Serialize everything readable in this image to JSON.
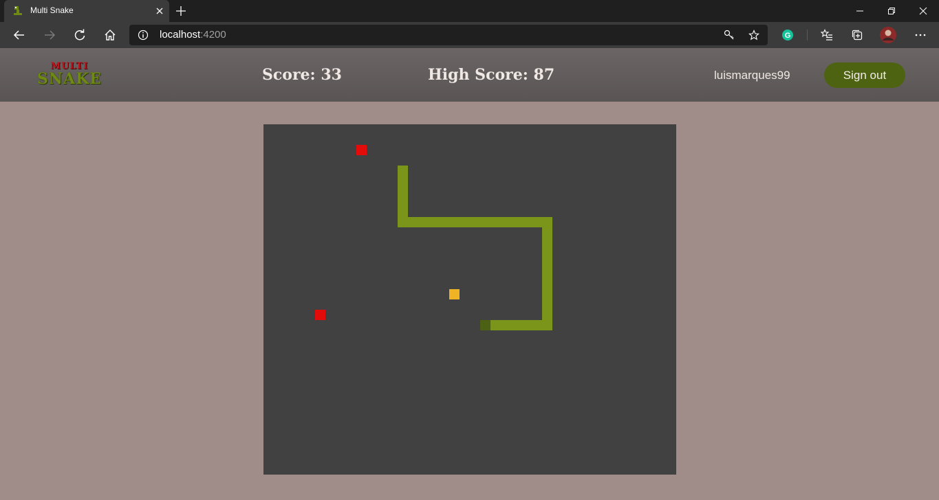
{
  "browser": {
    "tab_title": "Multi Snake",
    "url_host": "localhost",
    "url_port": ":4200",
    "icons": {
      "back": "arrow-left-icon",
      "forward": "arrow-right-icon",
      "refresh": "refresh-icon",
      "home": "home-icon",
      "info": "info-icon",
      "key": "key-icon",
      "favorite": "star-icon",
      "grammarly": "grammarly-icon",
      "favorites_bar": "favorites-icon",
      "collections": "collections-icon",
      "profile": "profile-avatar",
      "more": "more-icon"
    }
  },
  "header": {
    "logo_top": "MULTI",
    "logo_bottom": "SNAKE",
    "score_text": "Score: 33",
    "high_score_text": "High Score: 87",
    "username": "luismarques99",
    "signout_label": "Sign out"
  },
  "game": {
    "grid_columns": 40,
    "grid_rows": 34,
    "colors": {
      "board": "#414141",
      "snake_body": "#7a951a",
      "snake_tail": "#4d6114",
      "food": "#e40b0b",
      "bonus": "#f0b323"
    },
    "snake": [
      [
        13,
        4
      ],
      [
        13,
        5
      ],
      [
        13,
        6
      ],
      [
        13,
        7
      ],
      [
        13,
        8
      ],
      [
        13,
        9
      ],
      [
        14,
        9
      ],
      [
        15,
        9
      ],
      [
        16,
        9
      ],
      [
        17,
        9
      ],
      [
        18,
        9
      ],
      [
        19,
        9
      ],
      [
        20,
        9
      ],
      [
        21,
        9
      ],
      [
        22,
        9
      ],
      [
        23,
        9
      ],
      [
        24,
        9
      ],
      [
        25,
        9
      ],
      [
        26,
        9
      ],
      [
        27,
        9
      ],
      [
        27,
        10
      ],
      [
        27,
        11
      ],
      [
        27,
        12
      ],
      [
        27,
        13
      ],
      [
        27,
        14
      ],
      [
        27,
        15
      ],
      [
        27,
        16
      ],
      [
        27,
        17
      ],
      [
        27,
        18
      ],
      [
        27,
        19
      ],
      [
        26,
        19
      ],
      [
        25,
        19
      ],
      [
        24,
        19
      ],
      [
        23,
        19
      ],
      [
        22,
        19
      ],
      [
        21,
        19
      ]
    ],
    "food": [
      [
        9,
        2
      ],
      [
        5,
        18
      ]
    ],
    "bonus": [
      [
        18,
        16
      ]
    ]
  }
}
